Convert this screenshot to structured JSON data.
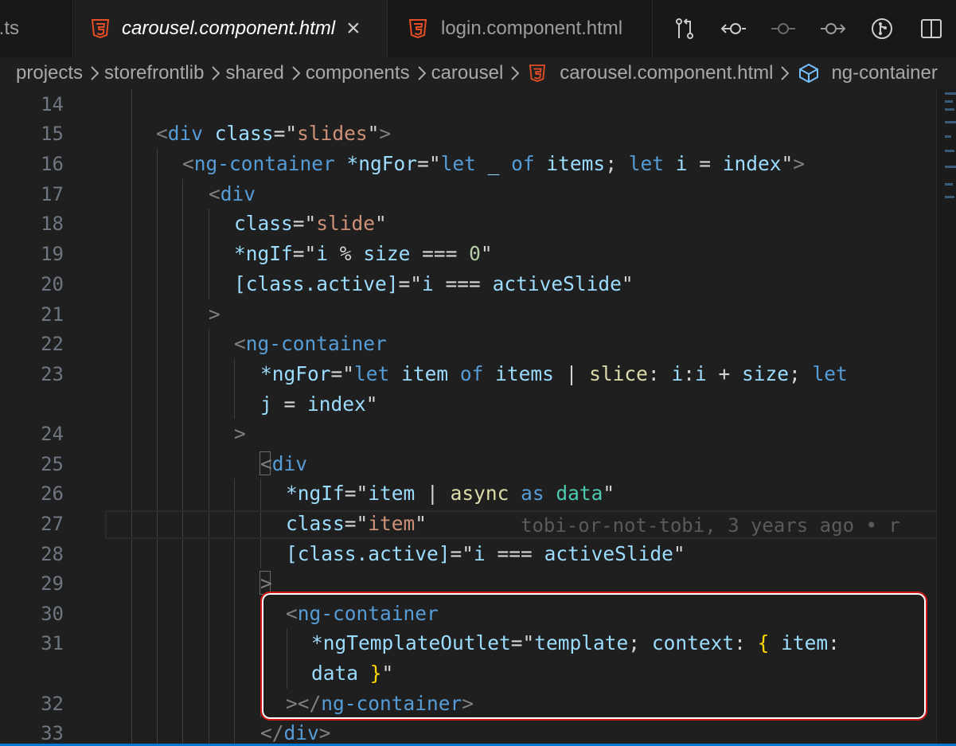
{
  "tabs": [
    {
      "label": "t.ts",
      "icon": "typescript-file-icon",
      "active": false
    },
    {
      "label": "carousel.component.html",
      "icon": "html5-icon",
      "active": true,
      "close": "×"
    },
    {
      "label": "login.component.html",
      "icon": "html5-icon",
      "active": false
    }
  ],
  "toolbar_icons": [
    "source-control-compare-icon",
    "previous-change-icon",
    "commit-icon",
    "next-change-icon",
    "git-lens-icon",
    "split-editor-icon"
  ],
  "breadcrumb": [
    "projects",
    "storefrontlib",
    "shared",
    "components",
    "carousel",
    "carousel.component.html",
    "ng-container"
  ],
  "line_numbers": [
    "14",
    "15",
    "16",
    "17",
    "18",
    "19",
    "20",
    "21",
    "22",
    "23",
    "",
    "24",
    "25",
    "26",
    "27",
    "28",
    "29",
    "30",
    "31",
    "",
    "32",
    "33"
  ],
  "code": {
    "l15": [
      "<",
      "div",
      " ",
      "class",
      "=\"",
      "slides",
      "\"",
      ">"
    ],
    "l16": [
      "<",
      "ng-container",
      " ",
      "*ngFor",
      "=\"",
      "let",
      " ",
      "_",
      " ",
      "of",
      " ",
      "items",
      "; ",
      "let",
      " ",
      "i",
      " = ",
      "index",
      "\"",
      ">"
    ],
    "l17": [
      "<",
      "div"
    ],
    "l18": [
      "class",
      "=\"",
      "slide",
      "\""
    ],
    "l19": [
      "*ngIf",
      "=\"",
      "i",
      " % ",
      "size",
      " === ",
      "0",
      "\""
    ],
    "l20": [
      "[class.active]",
      "=\"",
      "i",
      " === ",
      "activeSlide",
      "\""
    ],
    "l21": [
      ">"
    ],
    "l22": [
      "<",
      "ng-container"
    ],
    "l23a": [
      "*ngFor",
      "=\"",
      "let",
      " ",
      "item",
      " ",
      "of",
      " ",
      "items",
      " | ",
      "slice",
      ": ",
      "i",
      ":",
      "i",
      " + ",
      "size",
      "; ",
      "let"
    ],
    "l23b": [
      "j",
      " = ",
      "index",
      "\""
    ],
    "l24": [
      ">"
    ],
    "l25": [
      "<",
      "div"
    ],
    "l26": [
      "*ngIf",
      "=\"",
      "item",
      " | ",
      "async",
      " ",
      "as",
      " ",
      "data",
      "\""
    ],
    "l27": [
      "class",
      "=\"",
      "item",
      "\""
    ],
    "l28": [
      "[class.active]",
      "=\"",
      "i",
      " === ",
      "activeSlide",
      "\""
    ],
    "l29": [
      ">"
    ],
    "l30": [
      "<",
      "ng-container"
    ],
    "l31a": [
      "*ngTemplateOutlet",
      "=\"",
      "template",
      "; ",
      "context",
      ": ",
      "{",
      " ",
      "item",
      ":"
    ],
    "l31b": [
      "data",
      " ",
      "}",
      "\""
    ],
    "l32": [
      ">",
      "</",
      "ng-container",
      ">"
    ],
    "l33": [
      "</",
      "div",
      ">"
    ]
  },
  "blame": "tobi-or-not-tobi, 3 years ago • r",
  "colors": {
    "accent": "#0078d4",
    "highlight_box": "#d01717",
    "html_icon": "#e44d26"
  }
}
